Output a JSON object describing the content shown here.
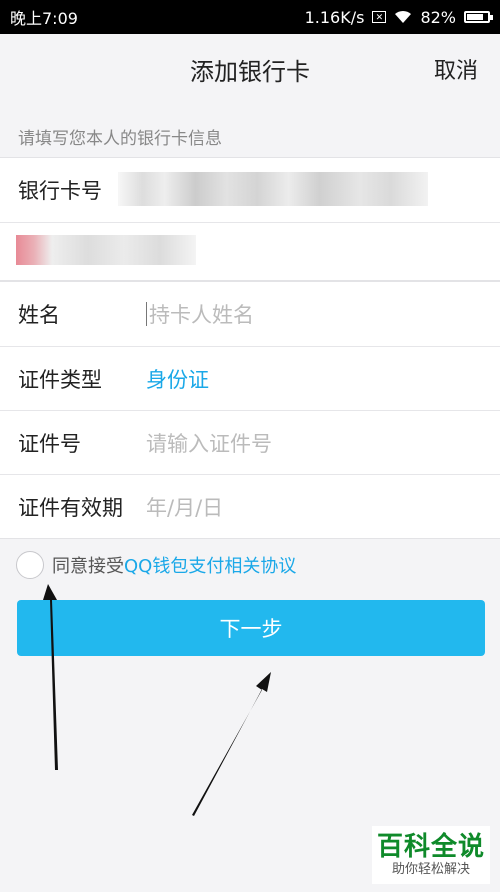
{
  "status_bar": {
    "time": "晚上7:09",
    "network_speed": "1.16K/s",
    "battery": "82%",
    "battery_level": 0.82
  },
  "nav": {
    "title": "添加银行卡",
    "cancel": "取消"
  },
  "hint": "请填写您本人的银行卡信息",
  "card_section": {
    "card_number_label": "银行卡号"
  },
  "form": {
    "name_label": "姓名",
    "name_placeholder": "持卡人姓名",
    "id_type_label": "证件类型",
    "id_type_value": "身份证",
    "id_number_label": "证件号",
    "id_number_placeholder": "请输入证件号",
    "expiry_label": "证件有效期",
    "expiry_placeholder": "年/月/日"
  },
  "agreement": {
    "prefix": "同意接受",
    "link": "QQ钱包支付相关协议"
  },
  "next_button": "下一步",
  "watermark": {
    "main": "百科全说",
    "sub": "助你轻松解决"
  },
  "colors": {
    "accent": "#22b8ee",
    "link": "#1aa8e8",
    "watermark": "#0f8a2a"
  }
}
